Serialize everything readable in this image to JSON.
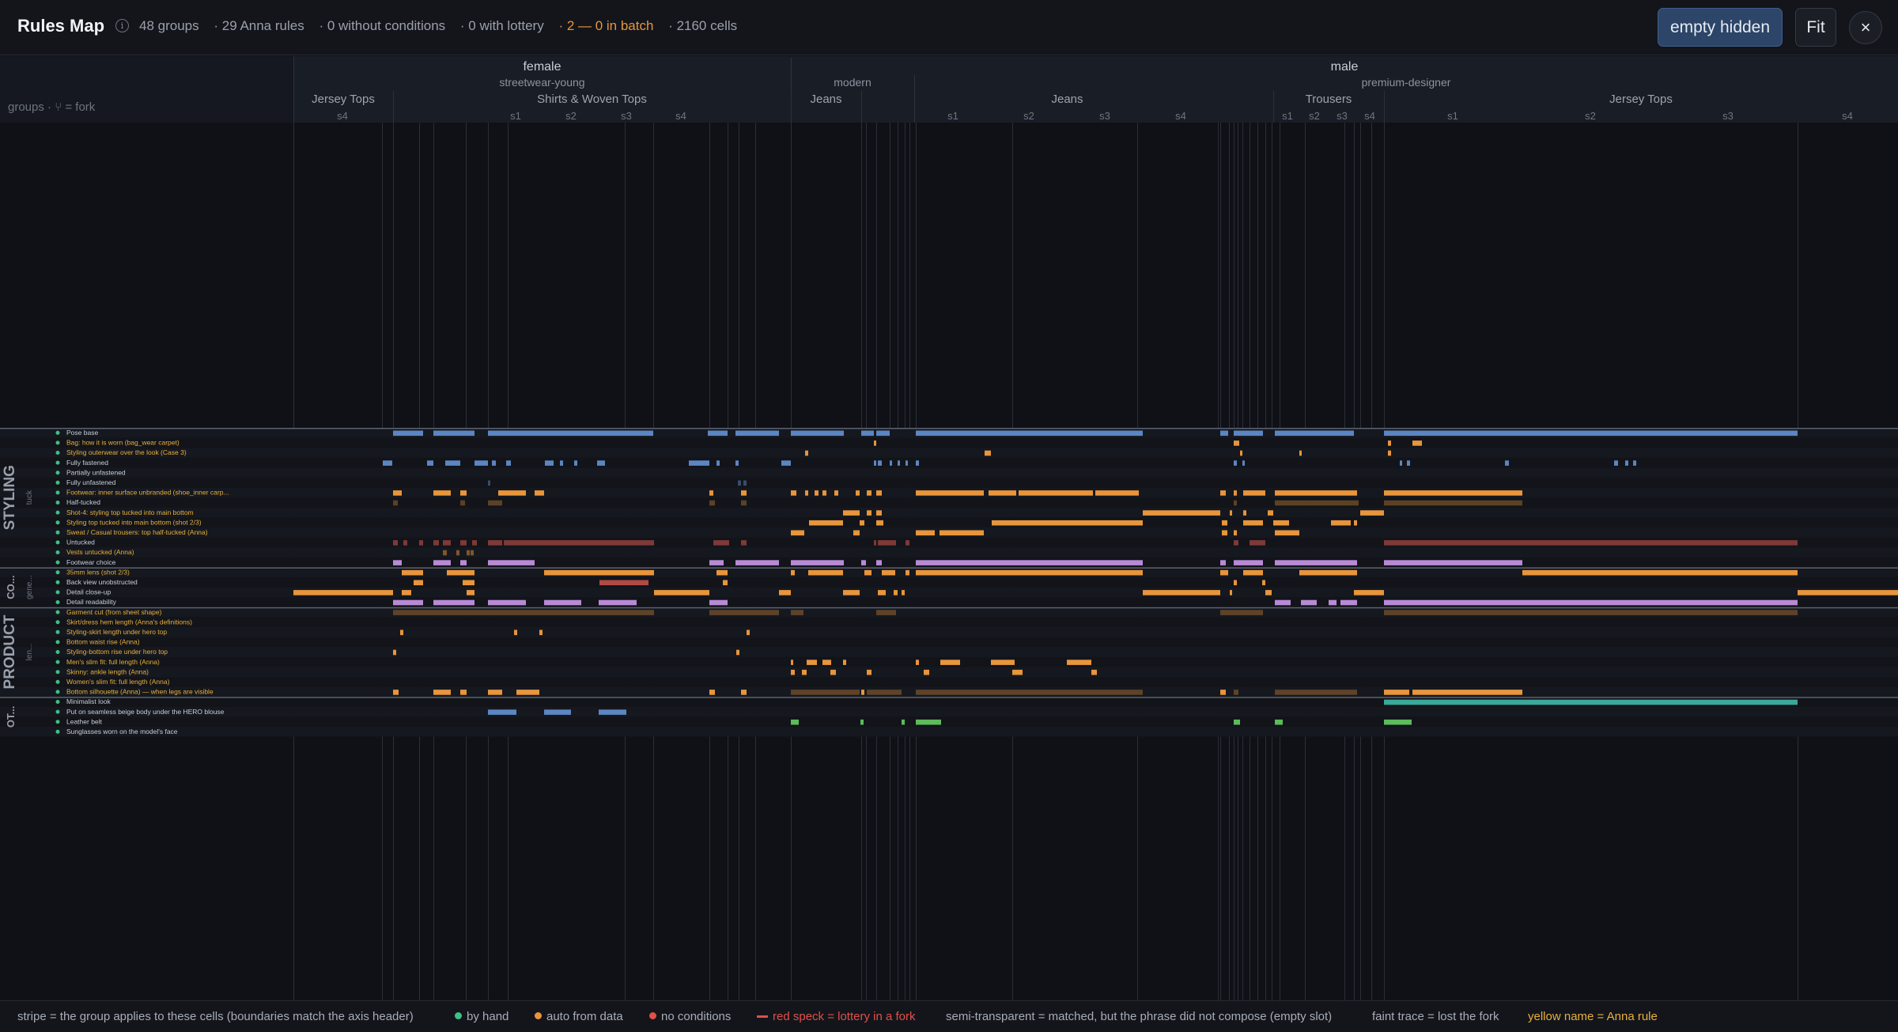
{
  "header": {
    "title": "Rules Map",
    "stats": [
      "48 groups",
      "· 29 Anna rules",
      "· 0 without conditions",
      "· 0 with lottery",
      "· 2 — 0 in batch",
      "· 2160 cells"
    ],
    "empty_hidden_label": "empty hidden",
    "fit_label": "Fit",
    "close_label": "×"
  },
  "axis": {
    "corner_label": "groups · ⑂ = fork",
    "genders": [
      "female",
      "male"
    ],
    "styles": [
      "streetwear-young",
      "modern",
      "premium-designer"
    ],
    "categories": [
      "Jersey Tops",
      "Shirts & Woven Tops",
      "Jeans",
      "Jeans",
      "Trousers",
      "Jersey Tops"
    ],
    "shots": [
      "s4",
      "s1",
      "s2",
      "s3",
      "s4",
      "s1",
      "s2",
      "s3",
      "s4",
      "s1",
      "s2",
      "s3",
      "s4",
      "s1",
      "s2",
      "s3",
      "s4"
    ]
  },
  "sections": [
    {
      "label": "STYLING",
      "sub": "tuck"
    },
    {
      "label": "CO...",
      "sub": "gene..."
    },
    {
      "label": "PRODUCT",
      "sub": "len..."
    },
    {
      "label": "OT..."
    }
  ],
  "rows": [
    "Pose base",
    "Bag: how it is worn (bag_wear carpet)",
    "Styling outerwear over the look (Case 3)",
    "Fully fastened",
    "Partially unfastened",
    "Fully unfastened",
    "Footwear: inner surface unbranded (shoe_inner carp...",
    "Half-tucked",
    "Shot-4: styling top tucked into main bottom",
    "Styling top tucked into main bottom (shot 2/3)",
    "Sweat / Casual trousers: top half-tucked (Anna)",
    "Untucked",
    "Vests untucked (Anna)",
    "Footwear choice",
    "35mm lens (shot 2/3)",
    "Back view unobstructed",
    "Detail close-up",
    "Detail readability",
    "Garment cut (from sheet shape)",
    "Skirt/dress hem length (Anna's definitions)",
    "Styling-skirt length under hero top",
    "Bottom waist rise (Anna)",
    "Styling-bottom rise under hero top",
    "Men's slim fit: full length (Anna)",
    "Skinny: ankle length (Anna)",
    "Women's slim fit: full length (Anna)",
    "Bottom silhouette (Anna) — when legs are visible",
    "Minimalist look",
    "Put on seamless beige body under the HERO blouse",
    "Leather belt",
    "Sunglasses worn on the model's face"
  ],
  "legend": {
    "stripe": "stripe = the group applies to these cells (boundaries match the axis header)",
    "by_hand": "by hand",
    "auto": "auto from data",
    "no_conditions": "no conditions",
    "lottery": "red speck = lottery in a fork",
    "semi": "semi-transparent = matched, but the phrase did not compose (empty slot)",
    "faint": "faint trace = lost the fork",
    "yellow": "yellow name = Anna rule"
  },
  "colors": {
    "blue": "#5b86c2",
    "orange": "#e8953c",
    "purple": "#b88ad6",
    "red": "#d9584e",
    "teal": "#3aa89a",
    "green": "#5dbb5b",
    "anna": "#e8b03c",
    "by_hand": "#3fbf86"
  }
}
